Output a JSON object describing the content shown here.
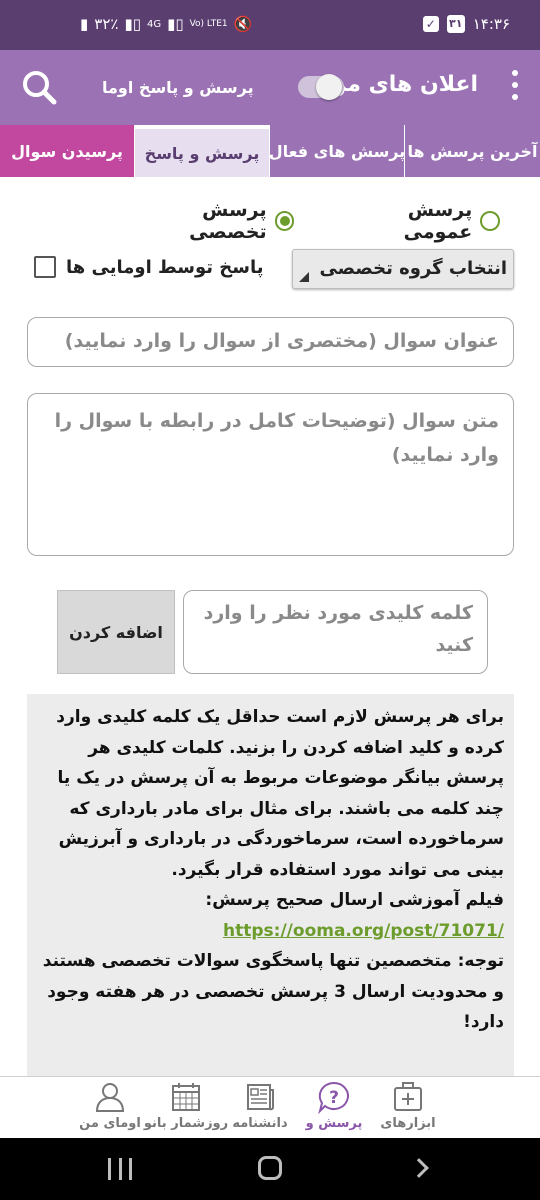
{
  "status_bar": {
    "time": "۱۴:۳۶",
    "calendar_day": "۳۱",
    "battery": "۳۲٪",
    "network_4g": "4G",
    "volte": "Vo) LTE1"
  },
  "app_bar": {
    "title": "اعلان های من",
    "subtitle": "پرسش و پاسخ اوما",
    "notifications_toggle": "off"
  },
  "tabs": [
    {
      "label": "آخرین پرسش ها"
    },
    {
      "label": "پرسش های فعال"
    },
    {
      "label": "پرسش و پاسخ"
    },
    {
      "label": "پرسیدن سوال"
    }
  ],
  "form": {
    "radio_specialized": "پرسش تخصصی",
    "radio_general": "پرسش عمومی",
    "group_select": "انتخاب گروه تخصصی",
    "ooma_answer_check": "پاسخ توسط اومایی ها",
    "title_placeholder": "عنوان سوال (مختصری از سوال را وارد نمایید)",
    "body_placeholder": "متن سوال (توضیحات کامل در رابطه با سوال را وارد نمایید)",
    "keyword_placeholder": "کلمه کلیدی مورد نظر را وارد کنید",
    "add_button": "اضافه کردن"
  },
  "info": {
    "paragraph": "برای هر پرسش لازم است حداقل یک کلمه کلیدی وارد کرده و کلید اضافه کردن را بزنید. کلمات کلیدی هر پرسش بیانگر موضوعات مربوط به آن پرسش در یک یا چند کلمه می باشند. برای مثال برای مادر بارداری که سرماخورده است، سرماخوردگی در بارداری و آبرزیش بینی می تواند مورد استفاده قرار بگیرد.",
    "video_label": "فیلم آموزشی ارسال صحیح پرسش:",
    "video_link": "https://ooma.org/post/71071/",
    "note": "توجه: متخصصین تنها پاسخگوی سوالات تخصصی هستند و محدودیت ارسال 3 پرسش تخصصی در هر هفته وجود دارد!"
  },
  "bottom_nav": [
    {
      "label": "ابزارهای",
      "icon": "medical-kit-icon"
    },
    {
      "label": "پرسش و",
      "icon": "question-bubble-icon",
      "active": true
    },
    {
      "label": "دانشنامه",
      "icon": "newspaper-icon"
    },
    {
      "label": "روزشمار بانو",
      "icon": "calendar-icon"
    },
    {
      "label": "اومای من",
      "icon": "person-icon"
    }
  ],
  "colors": {
    "primary": "#9b73b5",
    "status_bar": "#5a3e70",
    "ask_tab": "#c2489f",
    "accent_green": "#6c9c2b"
  }
}
